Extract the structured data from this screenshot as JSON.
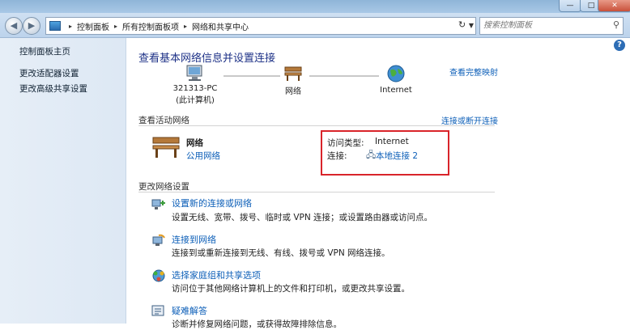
{
  "window": {
    "minimize": "—",
    "maximize": "□",
    "close": "✕"
  },
  "nav": {
    "breadcrumbs": [
      "控制面板",
      "所有控制面板项",
      "网络和共享中心"
    ],
    "search_placeholder": "搜索控制面板"
  },
  "sidebar": {
    "items": [
      {
        "label": "控制面板主页"
      },
      {
        "label": "更改适配器设置"
      },
      {
        "label": "更改高级共享设置"
      }
    ]
  },
  "main": {
    "title": "查看基本网络信息并设置连接",
    "view_full_map": "查看完整映射",
    "map": {
      "computer_name": "321313-PC",
      "computer_sub": "(此计算机)",
      "network": "网络",
      "internet": "Internet"
    },
    "active_networks": {
      "header": "查看活动网络",
      "connect_disconnect": "连接或断开连接",
      "network_name": "网络",
      "network_type": "公用网络",
      "access_type_label": "访问类型:",
      "access_type_value": "Internet",
      "connection_label": "连接:",
      "connection_value": "本地连接 2"
    },
    "change_settings": {
      "header": "更改网络设置",
      "tasks": [
        {
          "title": "设置新的连接或网络",
          "desc": "设置无线、宽带、拨号、临时或 VPN 连接；或设置路由器或访问点。",
          "icon": "new-connection-icon"
        },
        {
          "title": "连接到网络",
          "desc": "连接到或重新连接到无线、有线、拨号或 VPN 网络连接。",
          "icon": "connect-network-icon"
        },
        {
          "title": "选择家庭组和共享选项",
          "desc": "访问位于其他网络计算机上的文件和打印机，或更改共享设置。",
          "icon": "homegroup-icon"
        },
        {
          "title": "疑难解答",
          "desc": "诊断并修复网络问题，或获得故障排除信息。",
          "icon": "troubleshoot-icon"
        }
      ]
    }
  },
  "colors": {
    "link": "#0d5fb8",
    "title": "#1e3287",
    "highlight_box": "#d9242a"
  }
}
